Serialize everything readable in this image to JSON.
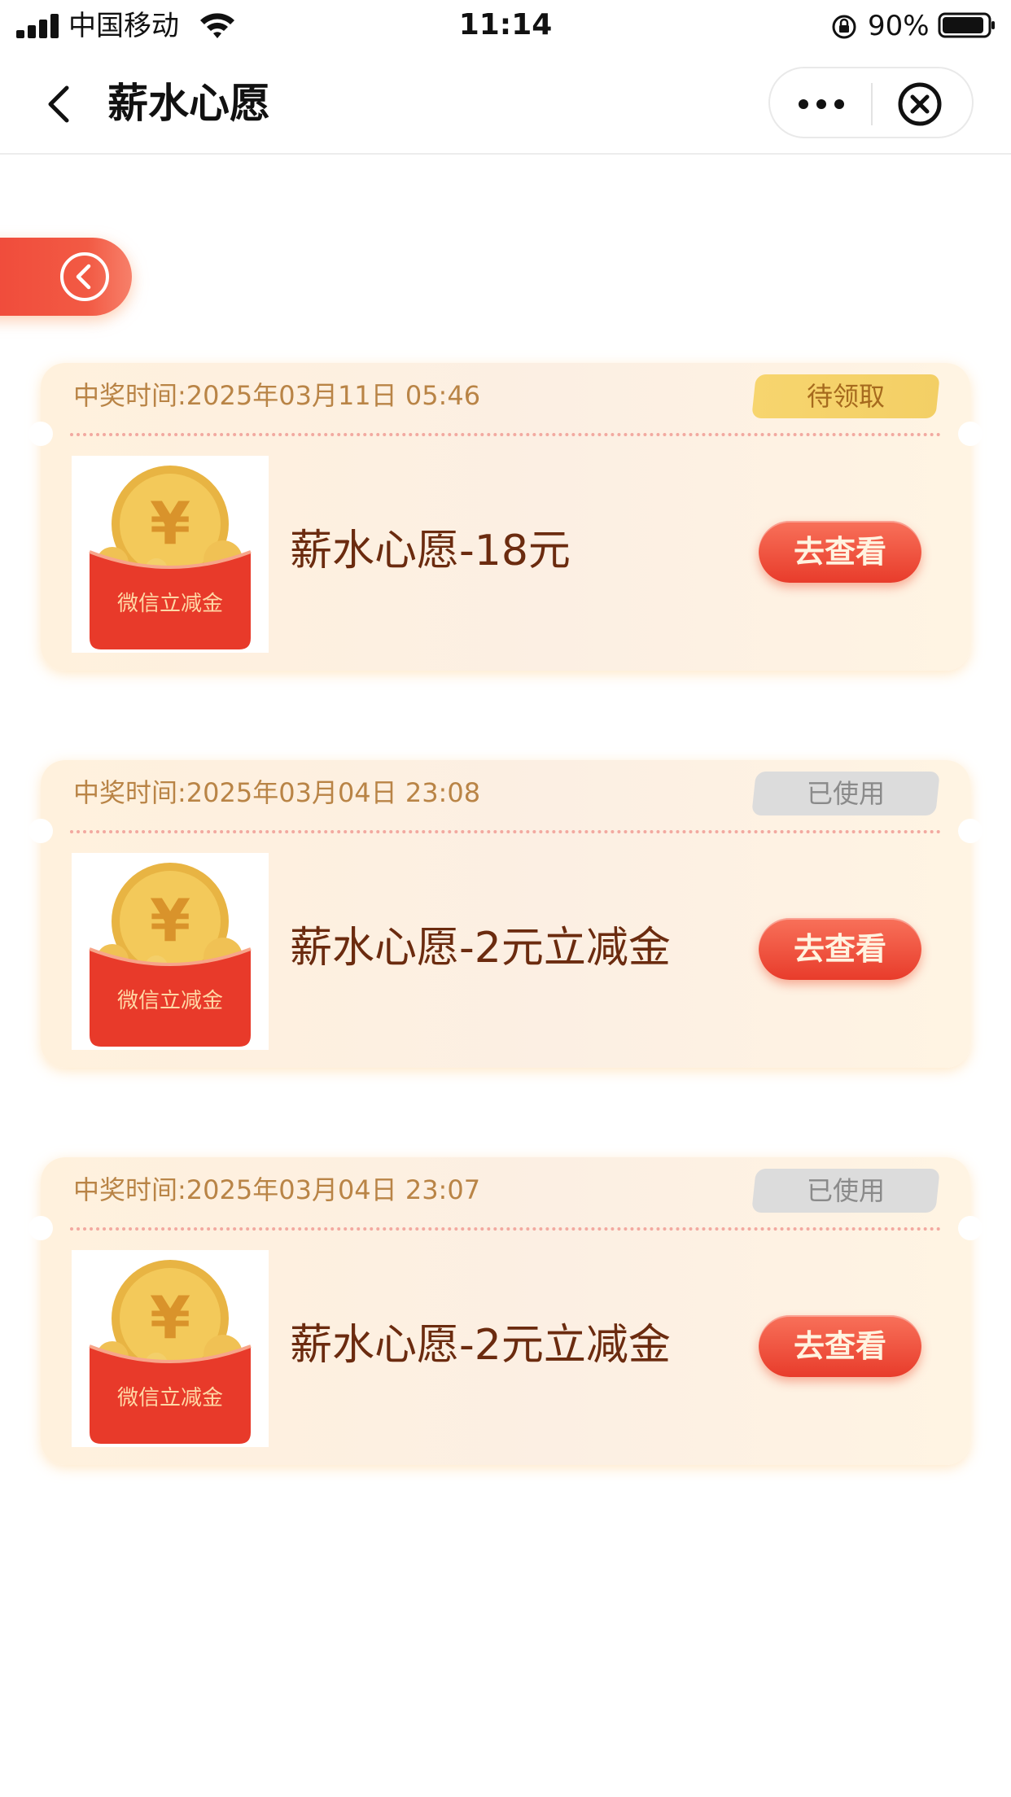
{
  "status_bar": {
    "carrier": "中国移动",
    "time": "11:14",
    "battery": "90%"
  },
  "nav": {
    "title": "薪水心愿"
  },
  "records": [
    {
      "win_time": "中奖时间:2025年03月11日 05:46",
      "status": "待领取",
      "status_type": "pending",
      "image_label": "微信立减金",
      "prize_name": "薪水心愿-18元",
      "button_label": "去查看"
    },
    {
      "win_time": "中奖时间:2025年03月04日 23:08",
      "status": "已使用",
      "status_type": "used",
      "image_label": "微信立减金",
      "prize_name": "薪水心愿-2元立减金",
      "button_label": "去查看"
    },
    {
      "win_time": "中奖时间:2025年03月04日 23:07",
      "status": "已使用",
      "status_type": "used",
      "image_label": "微信立减金",
      "prize_name": "薪水心愿-2元立减金",
      "button_label": "去查看"
    }
  ],
  "colors": {
    "accent_red": "#e83c2b",
    "title_brown": "#6b2b0f",
    "time_gold": "#b98446",
    "badge_pending": "#f3cf65",
    "badge_used": "#dcdcdc"
  }
}
